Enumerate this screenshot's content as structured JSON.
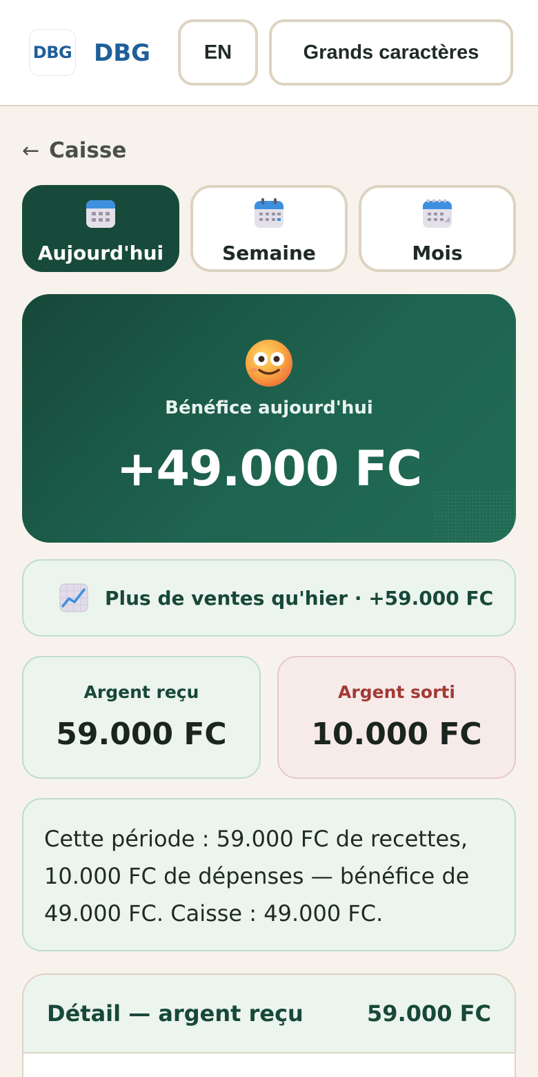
{
  "header": {
    "logo_text": "DBG",
    "brand_text": "DBG",
    "language_button": "EN",
    "large_text_button": "Grands caractères"
  },
  "nav": {
    "back_arrow": "←",
    "back_label": "Caisse"
  },
  "tabs": [
    {
      "label": "Aujourd'hui",
      "icon": "calendar-icon",
      "active": true
    },
    {
      "label": "Semaine",
      "icon": "calendar-icon",
      "active": false
    },
    {
      "label": "Mois",
      "icon": "calendar-icon",
      "active": false
    }
  ],
  "hero": {
    "icon": "smiling-face-icon",
    "label": "Bénéfice aujourd'hui",
    "value": "+49.000 FC"
  },
  "trend": {
    "icon": "chart-increasing-icon",
    "text": "Plus de ventes qu'hier · +59.000 FC"
  },
  "stats": {
    "received_label": "Argent reçu",
    "received_value": "59.000 FC",
    "spent_label": "Argent sorti",
    "spent_value": "10.000 FC"
  },
  "summary": {
    "text": "Cette période : 59.000 FC de recettes, 10.000 FC de dépenses — bénéfice de 49.000 FC. Caisse : 49.000 FC."
  },
  "detail": {
    "title": "Détail — argent reçu",
    "total": "59.000 FC"
  },
  "colors": {
    "primary_dark_green": "#174a3a",
    "brand_blue": "#1f5f99",
    "positive_bg": "#ecf4ee",
    "negative_bg": "#f7ebea",
    "negative_text": "#a23a34",
    "page_bg": "#f7f3ec"
  }
}
